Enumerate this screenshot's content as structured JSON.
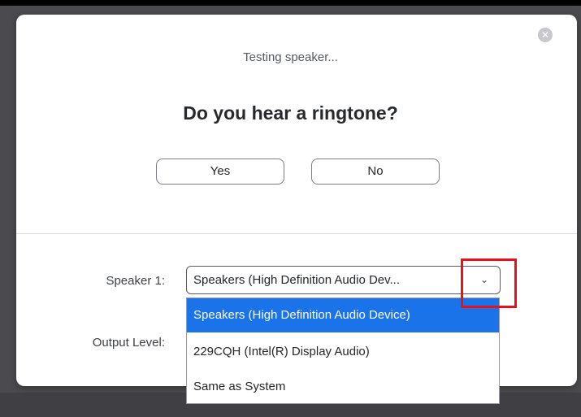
{
  "dialog": {
    "close_icon": "close-icon",
    "status_text": "Testing speaker...",
    "question": "Do you hear a ringtone?",
    "yes_label": "Yes",
    "no_label": "No"
  },
  "speaker": {
    "label": "Speaker 1:",
    "selected_display": "Speakers (High Definition Audio Dev...",
    "chevron_icon": "chevron-down-icon",
    "options": [
      "Speakers (High Definition Audio Device)",
      "229CQH (Intel(R) Display Audio)",
      "Same as System"
    ],
    "selected_index": 0
  },
  "output_level": {
    "label": "Output Level:"
  },
  "colors": {
    "selected_option_bg": "#1a73e8",
    "highlight_box": "#e8101a",
    "dialog_bg": "#ffffff",
    "backdrop": "#4b4b4f"
  }
}
